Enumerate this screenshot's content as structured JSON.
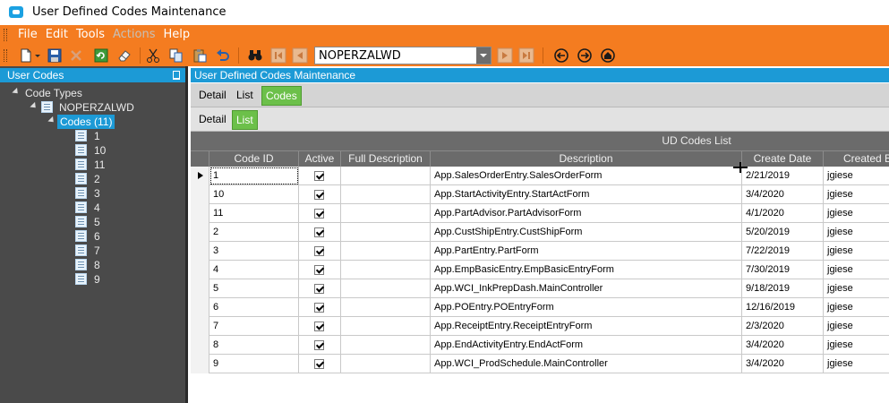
{
  "window": {
    "title": "User Defined Codes Maintenance"
  },
  "colors": {
    "accent_orange": "#f47c20",
    "header_blue": "#1c9ad6",
    "active_tab_green": "#6cc04a",
    "panel_dark": "#4a4a4a"
  },
  "menu": {
    "file": "File",
    "edit": "Edit",
    "tools": "Tools",
    "actions": "Actions",
    "help": "Help"
  },
  "toolbar": {
    "icons": [
      "new-icon",
      "save-icon",
      "delete-icon",
      "refresh-icon",
      "clear-icon",
      "cut-icon",
      "copy-icon",
      "paste-icon",
      "undo-icon",
      "search-icon",
      "first-record-icon",
      "previous-record-icon",
      "next-record-icon",
      "last-record-icon",
      "back-icon",
      "forward-icon",
      "home-icon"
    ],
    "combo_value": "NOPERZALWD"
  },
  "left_panel": {
    "title": "User Codes",
    "root": "Code Types",
    "type_node": "NOPERZALWD",
    "codes_node": "Codes (11)",
    "codes": [
      "1",
      "10",
      "11",
      "2",
      "3",
      "4",
      "5",
      "6",
      "7",
      "8",
      "9"
    ]
  },
  "right_panel": {
    "title": "User Defined Codes Maintenance",
    "tabs_top": [
      "Detail",
      "List",
      "Codes"
    ],
    "tabs_sub": [
      "Detail",
      "List"
    ],
    "grid_title": "UD Codes List",
    "columns": [
      "Code ID",
      "Active",
      "Full Description",
      "Description",
      "Create Date",
      "Created By"
    ],
    "rows": [
      {
        "code": "1",
        "active": true,
        "full": "",
        "desc": "App.SalesOrderEntry.SalesOrderForm",
        "date": "2/21/2019",
        "by": "jgiese"
      },
      {
        "code": "10",
        "active": true,
        "full": "",
        "desc": "App.StartActivityEntry.StartActForm",
        "date": "3/4/2020",
        "by": "jgiese"
      },
      {
        "code": "11",
        "active": true,
        "full": "",
        "desc": "App.PartAdvisor.PartAdvisorForm",
        "date": "4/1/2020",
        "by": "jgiese"
      },
      {
        "code": "2",
        "active": true,
        "full": "",
        "desc": "App.CustShipEntry.CustShipForm",
        "date": "5/20/2019",
        "by": "jgiese"
      },
      {
        "code": "3",
        "active": true,
        "full": "",
        "desc": "App.PartEntry.PartForm",
        "date": "7/22/2019",
        "by": "jgiese"
      },
      {
        "code": "4",
        "active": true,
        "full": "",
        "desc": "App.EmpBasicEntry.EmpBasicEntryForm",
        "date": "7/30/2019",
        "by": "jgiese"
      },
      {
        "code": "5",
        "active": true,
        "full": "",
        "desc": "App.WCI_InkPrepDash.MainController",
        "date": "9/18/2019",
        "by": "jgiese"
      },
      {
        "code": "6",
        "active": true,
        "full": "",
        "desc": "App.POEntry.POEntryForm",
        "date": "12/16/2019",
        "by": "jgiese"
      },
      {
        "code": "7",
        "active": true,
        "full": "",
        "desc": "App.ReceiptEntry.ReceiptEntryForm",
        "date": "2/3/2020",
        "by": "jgiese"
      },
      {
        "code": "8",
        "active": true,
        "full": "",
        "desc": "App.EndActivityEntry.EndActForm",
        "date": "3/4/2020",
        "by": "jgiese"
      },
      {
        "code": "9",
        "active": true,
        "full": "",
        "desc": "App.WCI_ProdSchedule.MainController",
        "date": "3/4/2020",
        "by": "jgiese"
      }
    ]
  }
}
